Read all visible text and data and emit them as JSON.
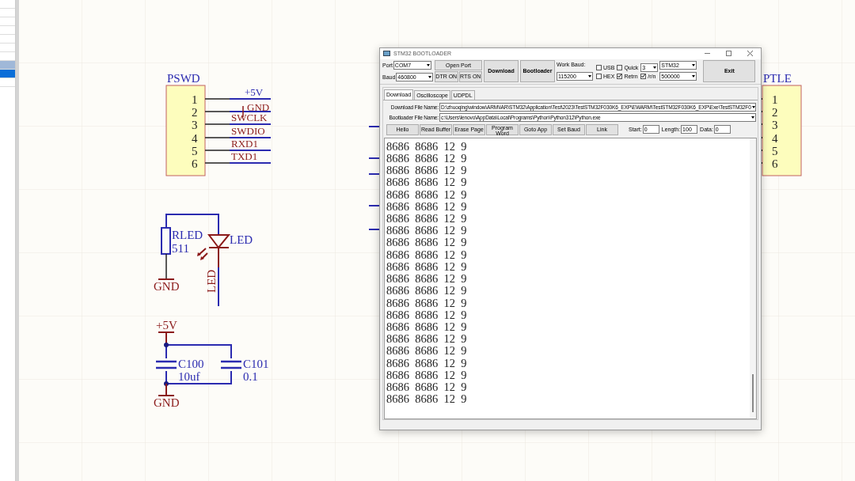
{
  "schematic": {
    "left_connector": {
      "title": "PSWD",
      "pins": [
        "1",
        "2",
        "3",
        "4",
        "5",
        "6"
      ],
      "nets": [
        "+5V",
        "GND",
        "SWCLK",
        "SWDIO",
        "RXD1",
        "TXD1"
      ]
    },
    "resistor": {
      "designator": "RLED",
      "value": "511",
      "ground": "GND"
    },
    "led": {
      "designator": "LED",
      "net": "LED"
    },
    "capacitors": [
      {
        "designator": "C100",
        "value": "10uf"
      },
      {
        "designator": "C101",
        "value": "0.1"
      }
    ],
    "decoupling_power": "+5V",
    "decoupling_ground": "GND",
    "right_connector": {
      "title": "PTLE",
      "pins": [
        "1",
        "2",
        "3",
        "4",
        "5",
        "6"
      ]
    }
  },
  "window": {
    "title": "STM32 BOOTLOADER",
    "port": {
      "label": "Port",
      "value": "COM7"
    },
    "baud": {
      "label": "Baud",
      "value": "460800"
    },
    "buttons_top": [
      "Open Port",
      "DTR ON",
      "RTS ON"
    ],
    "big_buttons": [
      "Download",
      "Bootloader"
    ],
    "work_baud": {
      "label": "Work Baud:",
      "value": "115200"
    },
    "checks": [
      {
        "label": "USB",
        "checked": false
      },
      {
        "label": "Quick",
        "checked": false
      },
      {
        "label": "HEX",
        "checked": false
      },
      {
        "label": "Retrn",
        "checked": true
      },
      {
        "label": "/r/n",
        "checked": true
      }
    ],
    "quick_value": "3",
    "chip": "STM32",
    "rate": "500000",
    "exit": "Exit",
    "tabs": [
      {
        "label": "Download",
        "selected": true
      },
      {
        "label": "Oscilloscope",
        "selected": false
      },
      {
        "label": "UDPDL",
        "selected": false
      }
    ],
    "download_file": {
      "label": "Download File Name:",
      "value": "D:\\zhuoqing\\window\\ARM\\IAR\\STM32\\Application\\Test\\2023\\TestSTM32F030K6_EXP\\EWARM\\TestSTM32F030K6_EXP\\Exe\\TestSTM32F0"
    },
    "bootloader_file": {
      "label": "Bootloader File Name:",
      "value": "c:\\Users\\lenovo\\AppData\\Local\\Programs\\Python\\Python312\\Python.exe"
    },
    "actions": [
      "Hello",
      "Read Buffer",
      "Erase Page",
      "Program Word",
      "Goto App",
      "Set Baud",
      "Link"
    ],
    "fields": [
      {
        "label": "Start:",
        "value": "0"
      },
      {
        "label": "Length:",
        "value": "100"
      },
      {
        "label": "Data:",
        "value": "0"
      }
    ],
    "output": [
      "8686  8686  12  9",
      "8686  8686  12  9",
      "8686  8686  12  9",
      "8686  8686  12  9",
      "8686  8686  12  9",
      "8686  8686  12  9",
      "8686  8686  12  9",
      "8686  8686  12  9",
      "8686  8686  12  9",
      "8686  8686  12  9",
      "8686  8686  12  9",
      "8686  8686  12  9",
      "8686  8686  12  9",
      "8686  8686  12  9",
      "8686  8686  12  9",
      "8686  8686  12  9",
      "8686  8686  12  9",
      "8686  8686  12  9",
      "8686  8686  12  9",
      "8686  8686  12  9",
      "8686  8686  12  9",
      "8686  8686  12  9"
    ]
  }
}
